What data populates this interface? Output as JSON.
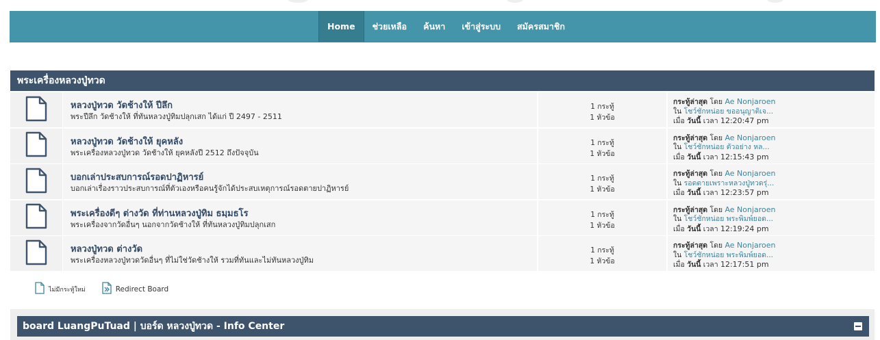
{
  "nav": {
    "items": [
      {
        "label": "Home",
        "active": true
      },
      {
        "label": "ช่วยเหลือ",
        "active": false
      },
      {
        "label": "ค้นหา",
        "active": false
      },
      {
        "label": "เข้าสู่ระบบ",
        "active": false
      },
      {
        "label": "สมัครสมาชิก",
        "active": false
      }
    ]
  },
  "category": {
    "title": "พระเครื่องหลวงปู่ทวด"
  },
  "boards": [
    {
      "title": "หลวงปู่ทวด วัดช้างให้ ปีลึก",
      "description": "พระปีลึก วัดช้างให้ ที่ทันหลวงปู่ทิมปลุกเสก ได้แก่ ปี 2497 - 2511",
      "posts": "1 กระทู้",
      "topics": "1 หัวข้อ",
      "last_post_label": "กระทู้ล่าสุด",
      "by": "โดย",
      "user": "Ae Nonjaroen",
      "in": "ใน",
      "topic": "โชว์ชักหน่อย ขออนุญาติเจ...",
      "when": "เมื่อ",
      "today": "วันนี้",
      "time_label": "เวลา",
      "time": "12:20:47 pm"
    },
    {
      "title": "หลวงปู่ทวด วัดช้างให้ ยุคหลัง",
      "description": "พระเครื่องหลวงปู่ทวด วัดช้างให้ ยุคหลังปี 2512 ถึงปัจจุบัน",
      "posts": "1 กระทู้",
      "topics": "1 หัวข้อ",
      "last_post_label": "กระทู้ล่าสุด",
      "by": "โดย",
      "user": "Ae Nonjaroen",
      "in": "ใน",
      "topic": "โชว์ชักหน่อย ตัวอย่าง หล...",
      "when": "เมื่อ",
      "today": "วันนี้",
      "time_label": "เวลา",
      "time": "12:15:43 pm"
    },
    {
      "title": "บอกเล่าประสบการณ์รอดปาฏิหารย์",
      "description": "บอกเล่าเรื่องราวประสบการณ์ที่ตัวเองหรือคนรู้จักได้ประสบเหตุการณ์รอดตายปาฏิหารย์",
      "posts": "1 กระทู้",
      "topics": "1 หัวข้อ",
      "last_post_label": "กระทู้ล่าสุด",
      "by": "โดย",
      "user": "Ae Nonjaroen",
      "in": "ใน",
      "topic": "รอดตายเพราะหลวงปู่ทวดรุ่...",
      "when": "เมื่อ",
      "today": "วันนี้",
      "time_label": "เวลา",
      "time": "12:23:57 pm"
    },
    {
      "title": "พระเครื่องดีๆ ต่างวัด ที่ท่านหลวงปู่ทิม ธมฺมธโร",
      "description": "พระเครื่องจากวัดอื่นๆ นอกจากวัดช้างให้ ที่ทันหลวงปู่ทิมปลุกเสก",
      "posts": "1 กระทู้",
      "topics": "1 หัวข้อ",
      "last_post_label": "กระทู้ล่าสุด",
      "by": "โดย",
      "user": "Ae Nonjaroen",
      "in": "ใน",
      "topic": "โชว์ชักหน่อย พระพิมพ์ยอด...",
      "when": "เมื่อ",
      "today": "วันนี้",
      "time_label": "เวลา",
      "time": "12:19:24 pm"
    },
    {
      "title": "หลวงปู่ทวด ต่างวัด",
      "description": "พระเครื่องหลวงปู่ทวดวัดอื่นๆ ที่ไม่ใช่วัดช้างให้ รวมที่ทันและไม่ทันหลวงปู่ทิม",
      "posts": "1 กระทู้",
      "topics": "1 หัวข้อ",
      "last_post_label": "กระทู้ล่าสุด",
      "by": "โดย",
      "user": "Ae Nonjaroen",
      "in": "ใน",
      "topic": "โชว์ชักหน่อย พระพิมพ์ยอด...",
      "when": "เมื่อ",
      "today": "วันนี้",
      "time_label": "เวลา",
      "time": "12:17:51 pm"
    }
  ],
  "legend": {
    "no_new_label": "ไม่มีกระทู้ใหม่",
    "redirect_label": "Redirect Board",
    "no_new_icon": "page-icon",
    "redirect_icon": "redirect-icon"
  },
  "info_center": {
    "title": "board LuangPuTuad | บอร์ด หลวงปู่ทวด - Info Center",
    "collapse_icon": "minus-icon"
  },
  "colors": {
    "nav_bg": "#4595aa",
    "header_bg": "#3e546c",
    "link": "#3a85a0",
    "board_title": "#334a66"
  }
}
